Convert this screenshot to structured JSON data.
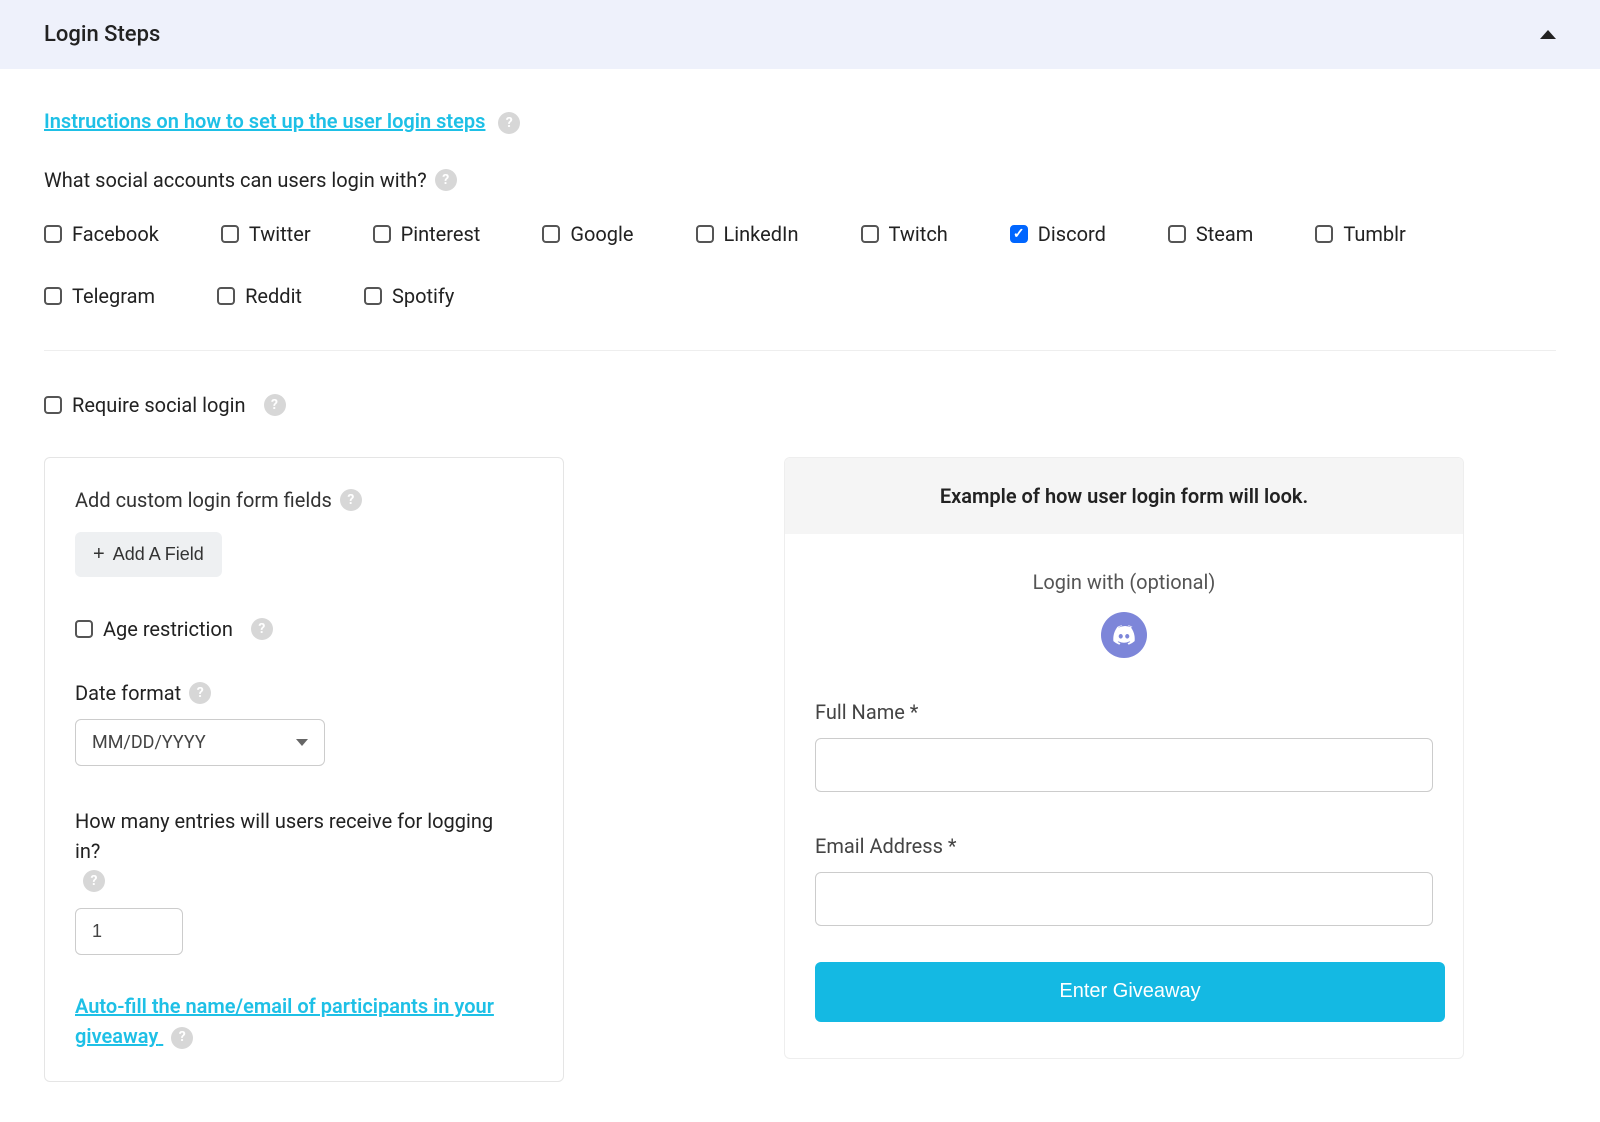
{
  "header": {
    "title": "Login Steps"
  },
  "instructions_link": "Instructions on how to set up the user login steps",
  "social_label": "What social accounts can users login with?",
  "social": [
    {
      "name": "Facebook",
      "checked": false
    },
    {
      "name": "Twitter",
      "checked": false
    },
    {
      "name": "Pinterest",
      "checked": false
    },
    {
      "name": "Google",
      "checked": false
    },
    {
      "name": "LinkedIn",
      "checked": false
    },
    {
      "name": "Twitch",
      "checked": false
    },
    {
      "name": "Discord",
      "checked": true
    },
    {
      "name": "Steam",
      "checked": false
    },
    {
      "name": "Tumblr",
      "checked": false
    },
    {
      "name": "Telegram",
      "checked": false
    },
    {
      "name": "Reddit",
      "checked": false
    },
    {
      "name": "Spotify",
      "checked": false
    }
  ],
  "require_social": {
    "label": "Require social login",
    "checked": false
  },
  "customfields": {
    "title": "Add custom login form fields",
    "add_label": "Add A Field",
    "age": {
      "label": "Age restriction",
      "checked": false
    },
    "dateformat": {
      "label": "Date format",
      "value": "MM/DD/YYYY"
    },
    "entries": {
      "label": "How many entries will users receive for logging in?",
      "value": "1"
    },
    "autofill_link": "Auto-fill the name/email of participants in your giveaway"
  },
  "preview": {
    "header": "Example of how user login form will look.",
    "loginwith": "Login with (optional)",
    "fullname": "Full Name *",
    "email": "Email Address *",
    "button": "Enter Giveaway"
  }
}
